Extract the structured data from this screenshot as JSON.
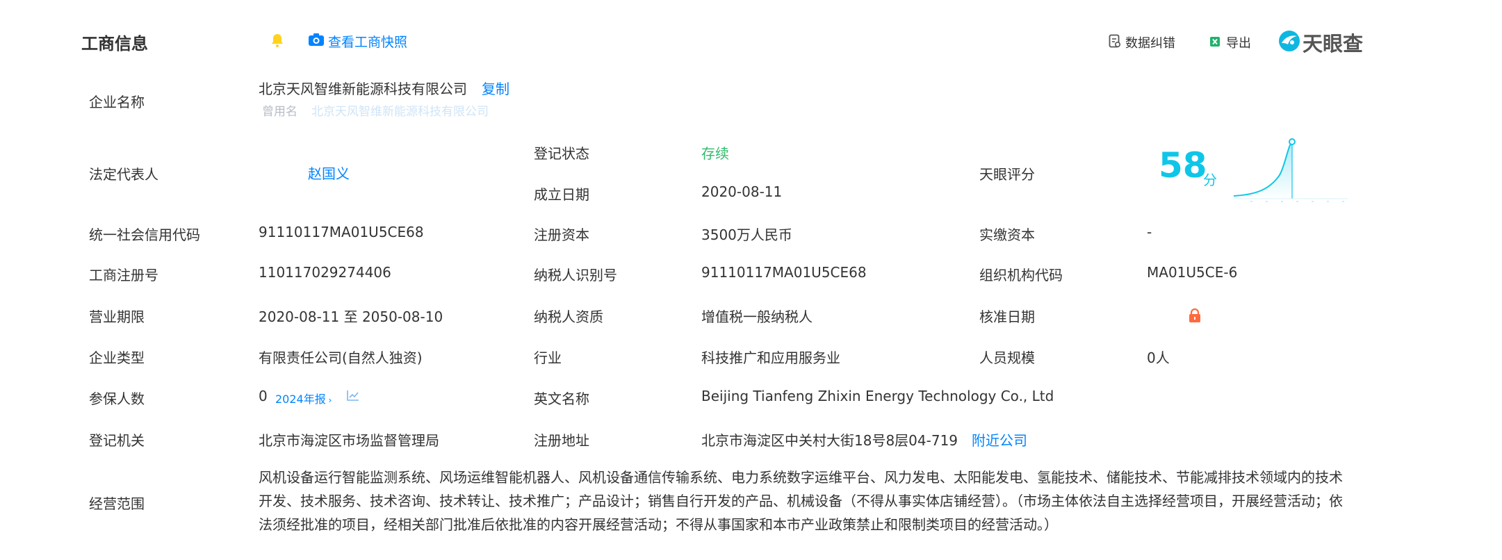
{
  "header": {
    "title": "工商信息",
    "snapshot_link": "查看工商快照",
    "data_correction": "数据纠错",
    "export": "导出",
    "brand": "天眼查"
  },
  "company": {
    "name_label": "企业名称",
    "name": "北京天风智维新能源科技有限公司",
    "copy": "复制",
    "former_name_label": "曾用名",
    "former_name": "北京天风智维新能源科技有限公司"
  },
  "legal_rep": {
    "label": "法定代表人",
    "value": "赵国义"
  },
  "reg_status": {
    "label": "登记状态",
    "value": "存续"
  },
  "founded": {
    "label": "成立日期",
    "value": "2020-08-11"
  },
  "score": {
    "label": "天眼评分",
    "value": "58",
    "unit": "分",
    "level": 58
  },
  "credit_code": {
    "label": "统一社会信用代码",
    "value": "91110117MA01U5CE68"
  },
  "reg_capital": {
    "label": "注册资本",
    "value": "3500万人民币"
  },
  "paid_capital": {
    "label": "实缴资本",
    "value": "-"
  },
  "reg_number": {
    "label": "工商注册号",
    "value": "110117029274406"
  },
  "taxpayer_id": {
    "label": "纳税人识别号",
    "value": "91110117MA01U5CE68"
  },
  "org_code": {
    "label": "组织机构代码",
    "value": "MA01U5CE-6"
  },
  "term": {
    "label": "营业期限",
    "value": "2020-08-11 至 2050-08-10"
  },
  "taxpayer_qual": {
    "label": "纳税人资质",
    "value": "增值税一般纳税人"
  },
  "approval_date": {
    "label": "核准日期"
  },
  "company_type": {
    "label": "企业类型",
    "value": "有限责任公司(自然人独资)"
  },
  "industry": {
    "label": "行业",
    "value": "科技推广和应用服务业"
  },
  "staff_size": {
    "label": "人员规模",
    "value": "0人"
  },
  "insured": {
    "label": "参保人数",
    "value": "0",
    "report": "2024年报"
  },
  "english_name": {
    "label": "英文名称",
    "value": "Beijing Tianfeng Zhixin Energy Technology Co., Ltd"
  },
  "reg_authority": {
    "label": "登记机关",
    "value": "北京市海淀区市场监督管理局"
  },
  "reg_address": {
    "label": "注册地址",
    "value": "北京市海淀区中关村大街18号8层04-719",
    "nearby": "附近公司"
  },
  "business_scope": {
    "label": "经营范围",
    "value": "风机设备运行智能监测系统、风场运维智能机器人、风机设备通信传输系统、电力系统数字运维平台、风力发电、太阳能发电、氢能技术、储能技术、节能减排技术领域内的技术开发、技术服务、技术咨询、技术转让、技术推广；产品设计；销售自行开发的产品、机械设备（不得从事实体店铺经营）。（市场主体依法自主选择经营项目，开展经营活动；依法须经批准的项目，经相关部门批准后依批准的内容开展经营活动；不得从事国家和本市产业政策禁止和限制类项目的经营活动。）"
  },
  "colors": {
    "link": "#0084ff",
    "status_green": "#2fbb6b",
    "score_cyan": "#0fc6e8",
    "lock_orange": "#ff6a3d",
    "bell_yellow": "#ffd21f"
  }
}
